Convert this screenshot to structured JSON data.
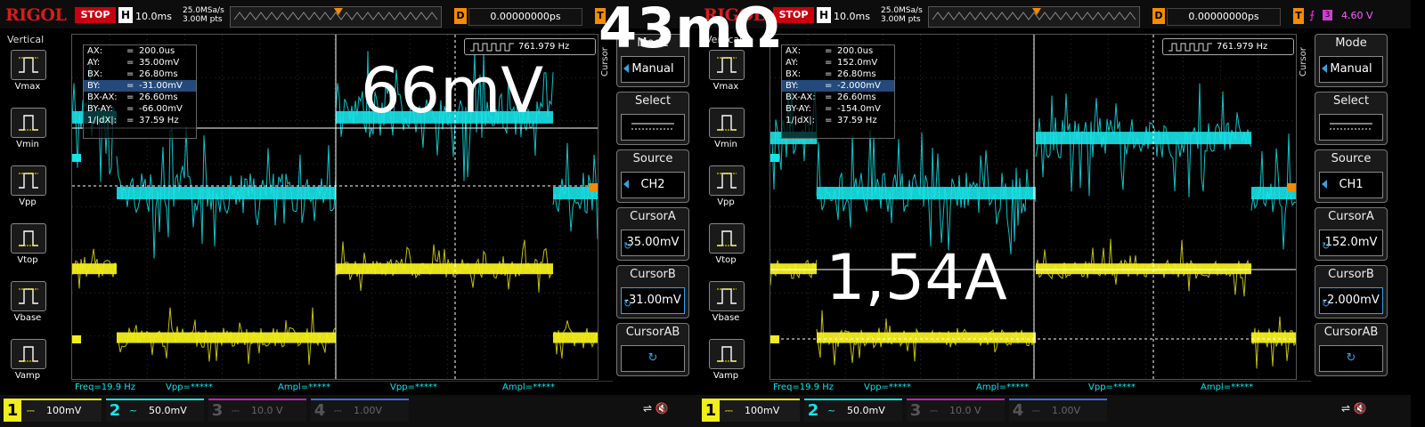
{
  "left": {
    "logo": "RIGOL",
    "run_state": "STOP",
    "timebase_key": "H",
    "timebase": "10.0ms",
    "sample_rate": "25.0MSa/s",
    "memory": "3.00M pts",
    "delay_key": "D",
    "delay": "0.00000000ps",
    "trigger_key": "T",
    "vertical_label": "Vertical",
    "meas_buttons": [
      "Vmax",
      "Vmin",
      "Vpp",
      "Vtop",
      "Vbase",
      "Vamp"
    ],
    "cursor_readout": [
      {
        "k": "AX:",
        "v": "200.0us"
      },
      {
        "k": "AY:",
        "v": "35.00mV"
      },
      {
        "k": "BX:",
        "v": "26.80ms"
      },
      {
        "k": "BY:",
        "v": "-31.00mV"
      },
      {
        "k": "BX-AX:",
        "v": "26.60ms"
      },
      {
        "k": "BY-AY:",
        "v": "-66.00mV"
      },
      {
        "k": "1/|dX|:",
        "v": "37.59 Hz"
      }
    ],
    "freq_counter": "761.979 Hz",
    "cursor_tab": "Cursor",
    "mode_head": "Mode",
    "mode_val": "Manual",
    "select_head": "Select",
    "source_head": "Source",
    "source_val": "CH2",
    "cursora_head": "CursorA",
    "cursora_val": "35.00mV",
    "cursorb_head": "CursorB",
    "cursorb_val": "-31.00mV",
    "cursorab_head": "CursorAB",
    "measurements": [
      "Freq=19.9 Hz",
      "Vpp=*****",
      "Ampl=*****",
      "Vpp=*****",
      "Ampl=*****"
    ],
    "channels": [
      {
        "num": "1",
        "coupling": "⎓",
        "scale": "100mV"
      },
      {
        "num": "2",
        "coupling": "~",
        "scale": "50.0mV"
      },
      {
        "num": "3",
        "coupling": "⎓",
        "scale": "10.0 V"
      },
      {
        "num": "4",
        "coupling": "⎓",
        "scale": "1.00V"
      }
    ],
    "annotation": "66mV"
  },
  "right": {
    "logo": "RIGOL",
    "run_state": "STOP",
    "timebase_key": "H",
    "timebase": "10.0ms",
    "sample_rate": "25.0MSa/s",
    "memory": "3.00M pts",
    "delay_key": "D",
    "delay": "0.00000000ps",
    "trigger_key": "T",
    "trigger_source": "3",
    "trigger_level": "4.60 V",
    "vertical_label": "Vertical",
    "meas_buttons": [
      "Vmax",
      "Vmin",
      "Vpp",
      "Vtop",
      "Vbase",
      "Vamp"
    ],
    "cursor_readout": [
      {
        "k": "AX:",
        "v": "200.0us"
      },
      {
        "k": "AY:",
        "v": "152.0mV"
      },
      {
        "k": "BX:",
        "v": "26.80ms"
      },
      {
        "k": "BY:",
        "v": "-2.000mV"
      },
      {
        "k": "BX-AX:",
        "v": "26.60ms"
      },
      {
        "k": "BY-AY:",
        "v": "-154.0mV"
      },
      {
        "k": "1/|dX|:",
        "v": "37.59 Hz"
      }
    ],
    "freq_counter": "761.979 Hz",
    "cursor_tab": "Cursor",
    "mode_head": "Mode",
    "mode_val": "Manual",
    "select_head": "Select",
    "source_head": "Source",
    "source_val": "CH1",
    "cursora_head": "CursorA",
    "cursora_val": "152.0mV",
    "cursorb_head": "CursorB",
    "cursorb_val": "-2.000mV",
    "cursorab_head": "CursorAB",
    "measurements": [
      "Freq=19.9 Hz",
      "Vpp=*****",
      "Ampl=*****",
      "Vpp=*****",
      "Ampl=*****"
    ],
    "channels": [
      {
        "num": "1",
        "coupling": "⎓",
        "scale": "100mV"
      },
      {
        "num": "2",
        "coupling": "~",
        "scale": "50.0mV"
      },
      {
        "num": "3",
        "coupling": "⎓",
        "scale": "10.0 V"
      },
      {
        "num": "4",
        "coupling": "⎓",
        "scale": "1.00V"
      }
    ],
    "annotation": "1,54A"
  },
  "overlay_title": "43mΩ",
  "colors": {
    "ch1": "#f2ee1c",
    "ch2": "#19e3e8",
    "ch3": "#c21fc2",
    "ch4": "#3a6ee0",
    "accent": "#f58b00",
    "stop": "#c8000f"
  },
  "waveforms": {
    "left": {
      "ch2_on_level": 0.24,
      "ch2_off_level": 0.46,
      "ch1_on_level": 0.68,
      "ch1_off_level": 0.88
    },
    "right": {
      "ch2_on_level": 0.3,
      "ch2_off_level": 0.46,
      "ch1_on_level": 0.68,
      "ch1_off_level": 0.88
    }
  }
}
